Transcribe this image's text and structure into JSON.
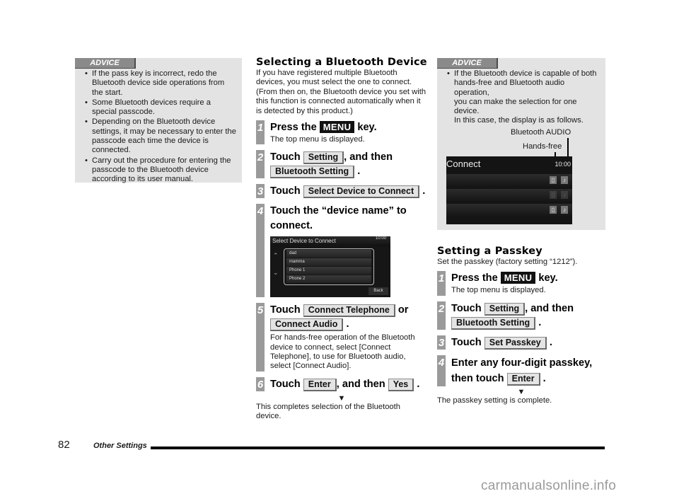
{
  "left_advice": {
    "tag": "ADVICE",
    "items": [
      "If the pass key is incorrect, redo the Bluetooth device side operations from the start.",
      "Some Bluetooth devices require a special passcode.",
      "Depending on the Bluetooth device settings, it may be necessary to enter the passcode each time the device is connected.",
      "Carry out the procedure for entering the passcode to the Bluetooth device according to its user manual."
    ]
  },
  "select_section": {
    "title": "Selecting a Bluetooth Device",
    "intro": "If you have registered multiple Bluetooth devices, you must select the one to connect. (From then on, the Bluetooth device you set with this function is connected automatically when it is detected by this product.)",
    "steps": [
      {
        "num": "1",
        "pre": "Press the",
        "key": "MENU",
        "post": "key.",
        "sub": "The top menu is displayed."
      },
      {
        "num": "2",
        "pre": "Touch",
        "btn1": "Setting",
        "mid": ", and then",
        "btn2": "Bluetooth Setting",
        "post": "."
      },
      {
        "num": "3",
        "pre": "Touch",
        "btn1": "Select Device to Connect",
        "post": "."
      },
      {
        "num": "4",
        "text": "Touch the “device name” to connect."
      },
      {
        "num": "5",
        "pre": "Touch",
        "btn1": "Connect Telephone",
        "mid": "or",
        "btn2": "Connect Audio",
        "post": ".",
        "sub": "For hands-free operation of the Bluetooth device to connect, select [Connect Telephone], to use for Bluetooth audio, select [Connect Audio]."
      },
      {
        "num": "6",
        "pre": "Touch",
        "btn1": "Enter",
        "mid": ", and then",
        "btn2": "Yes",
        "post": "."
      }
    ],
    "arrow": "▼",
    "result": "This completes selection of the Bluetooth device.",
    "screen": {
      "title": "Select Device to Connect",
      "time": "10:00",
      "devices": [
        "dad",
        "mamma",
        "Phone 1",
        "Phone 2"
      ],
      "back": "Back"
    }
  },
  "right_advice": {
    "tag": "ADVICE",
    "text": "If the Bluetooth device is capable of both hands-free and Bluetooth audio operation,",
    "text2": "you can make the selection for one device.",
    "text3": "In this case, the display is as follows.",
    "callout_audio": "Bluetooth AUDIO",
    "callout_handsfree": "Hands-free",
    "screen": {
      "title": "Connect",
      "time": "10:00"
    }
  },
  "passkey_section": {
    "title": "Setting a Passkey",
    "intro": "Set the passkey (factory setting “1212”).",
    "steps": [
      {
        "num": "1",
        "pre": "Press the",
        "key": "MENU",
        "post": "key.",
        "sub": "The top menu is displayed."
      },
      {
        "num": "2",
        "pre": "Touch",
        "btn1": "Setting",
        "mid": ", and then",
        "btn2": "Bluetooth Setting",
        "post": "."
      },
      {
        "num": "3",
        "pre": "Touch",
        "btn1": "Set Passkey",
        "post": "."
      },
      {
        "num": "4",
        "pre": "Enter any four-digit passkey, then touch",
        "btn1": "Enter",
        "post": "."
      }
    ],
    "arrow": "▼",
    "result": "The passkey setting is complete."
  },
  "footer": {
    "page": "82",
    "label": "Other Settings"
  },
  "watermark": "carmanualsonline.info"
}
